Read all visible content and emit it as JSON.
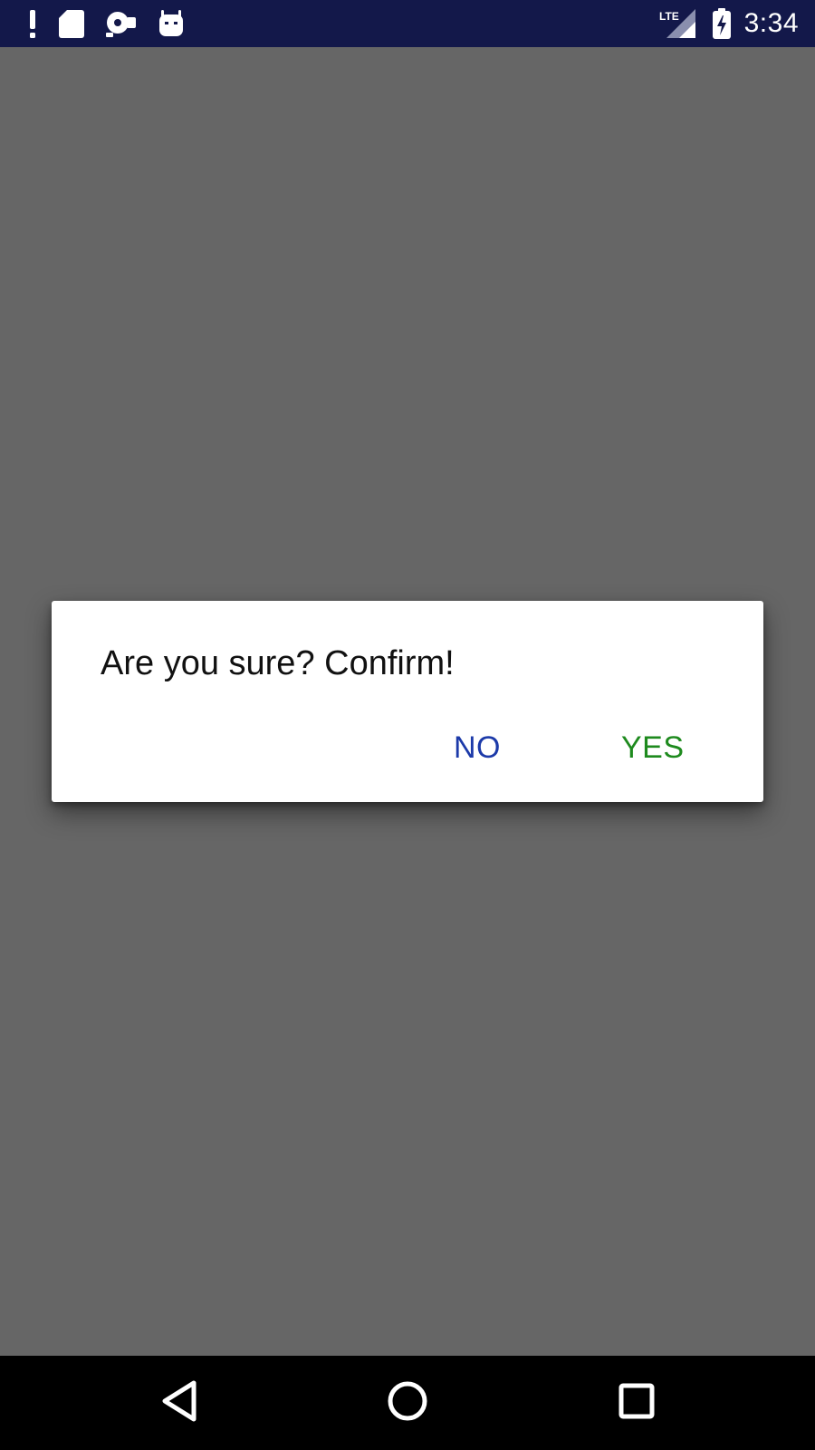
{
  "status_bar": {
    "time": "3:34",
    "network_label": "LTE",
    "icons_left": [
      "alert-icon",
      "sd-card-icon",
      "media-icon",
      "android-icon"
    ],
    "icons_right": [
      "signal-icon",
      "battery-charging-icon"
    ]
  },
  "dialog": {
    "message": "Are you sure? Confirm!",
    "negative_label": "NO",
    "positive_label": "YES"
  },
  "nav_bar": {
    "icons": [
      "back-icon",
      "home-icon",
      "recents-icon"
    ]
  },
  "colors": {
    "status_bar": "#13184a",
    "scrim": "#666666",
    "dialog_bg": "#ffffff",
    "no_button": "#1c3aa9",
    "yes_button": "#1e8a1e",
    "nav_bar": "#000000"
  }
}
